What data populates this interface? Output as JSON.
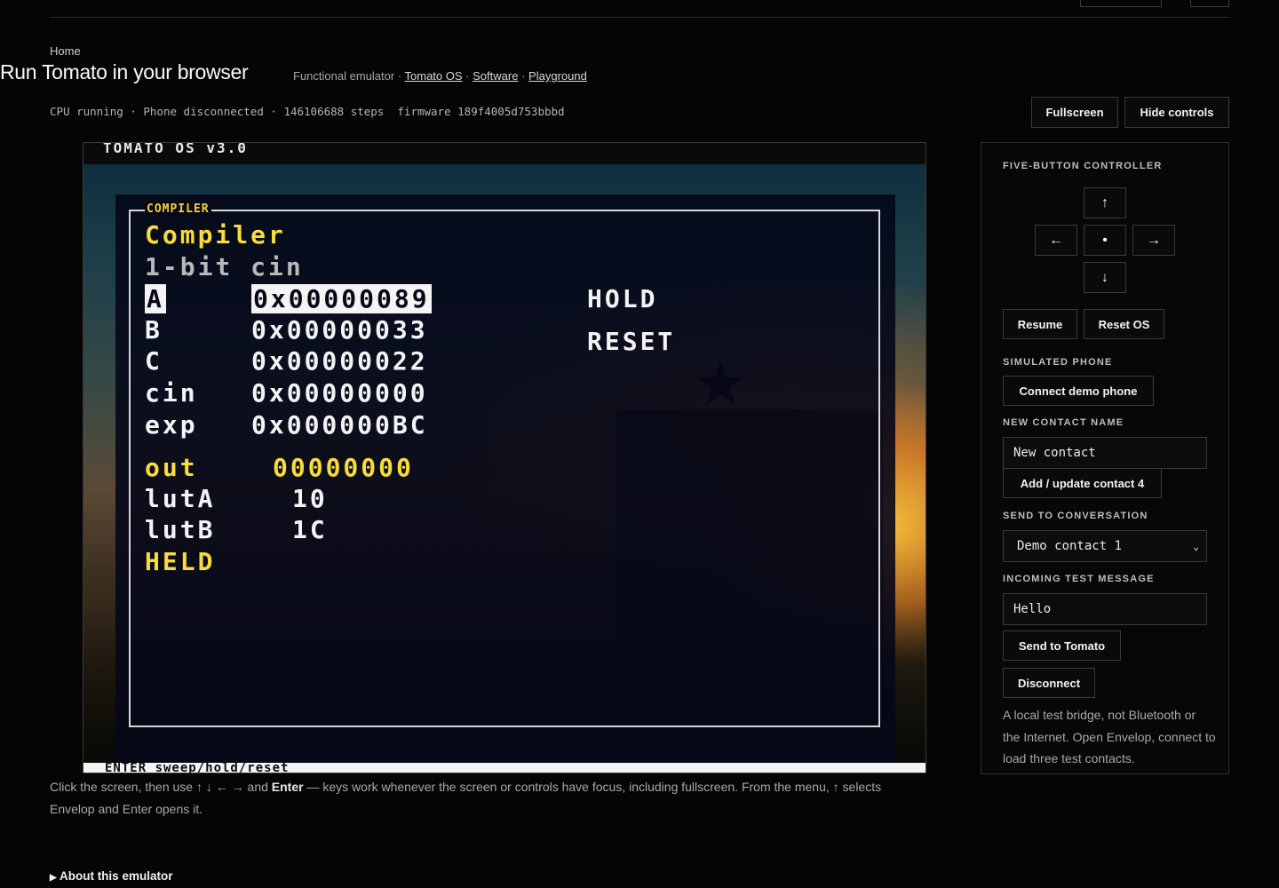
{
  "breadcrumb": "Home",
  "page_title": "Run Tomato in your browser",
  "subline": {
    "prefix": "Functional emulator ·",
    "links": [
      "Tomato OS",
      "Software",
      "Playground"
    ],
    "sep": "·"
  },
  "status": {
    "cpu": "CPU running",
    "phone": "Phone disconnected",
    "steps": "146106688 steps",
    "firmware": "firmware 189f4005d753bbbd",
    "sep": "·"
  },
  "toolbar": {
    "fullscreen": "Fullscreen",
    "hide_controls": "Hide controls"
  },
  "screen": {
    "header": "TOMATO OS  v3.0",
    "frame_title": "COMPILER",
    "heading": "Compiler",
    "subheading": "1-bit cin",
    "registers": [
      {
        "name": "A",
        "value": "0x00000089"
      },
      {
        "name": "B",
        "value": "0x00000033"
      },
      {
        "name": "C",
        "value": "0x00000022"
      },
      {
        "name": "cin",
        "value": "0x00000000"
      },
      {
        "name": "exp",
        "value": "0x000000BC"
      }
    ],
    "actions": [
      "HOLD",
      "RESET"
    ],
    "out_label": "out",
    "out_value": "00000000",
    "luts": [
      {
        "name": "lutA",
        "value": "10"
      },
      {
        "name": "lutB",
        "value": "1C"
      }
    ],
    "held": "HELD",
    "footer": "ENTER sweep/hold/reset"
  },
  "hint": {
    "part1": "Click the screen, then use",
    "arrows": "↑ ↓ ← →",
    "part2": "and",
    "enter": "Enter",
    "part3": "— keys work whenever the screen or controls have focus, including fullscreen. From the menu, ↑ selects Envelop and Enter opens it."
  },
  "about": "About this emulator",
  "controls": {
    "controller_label": "FIVE-BUTTON CONTROLLER",
    "up": "↑",
    "left": "←",
    "center": "•",
    "right": "→",
    "down": "↓",
    "resume": "Resume",
    "reset_os": "Reset OS",
    "phone_label": "SIMULATED PHONE",
    "connect": "Connect demo phone",
    "contact_label": "NEW CONTACT NAME",
    "contact_value": "New contact",
    "add_update": "Add / update contact 4",
    "send_to_label": "SEND TO CONVERSATION",
    "send_to_value": "Demo contact 1",
    "incoming_label": "INCOMING TEST MESSAGE",
    "incoming_value": "Hello",
    "send_btn": "Send to Tomato",
    "disconnect": "Disconnect",
    "note": "A local test bridge, not Bluetooth or the Internet. Open Envelop, connect to load three test contacts."
  }
}
